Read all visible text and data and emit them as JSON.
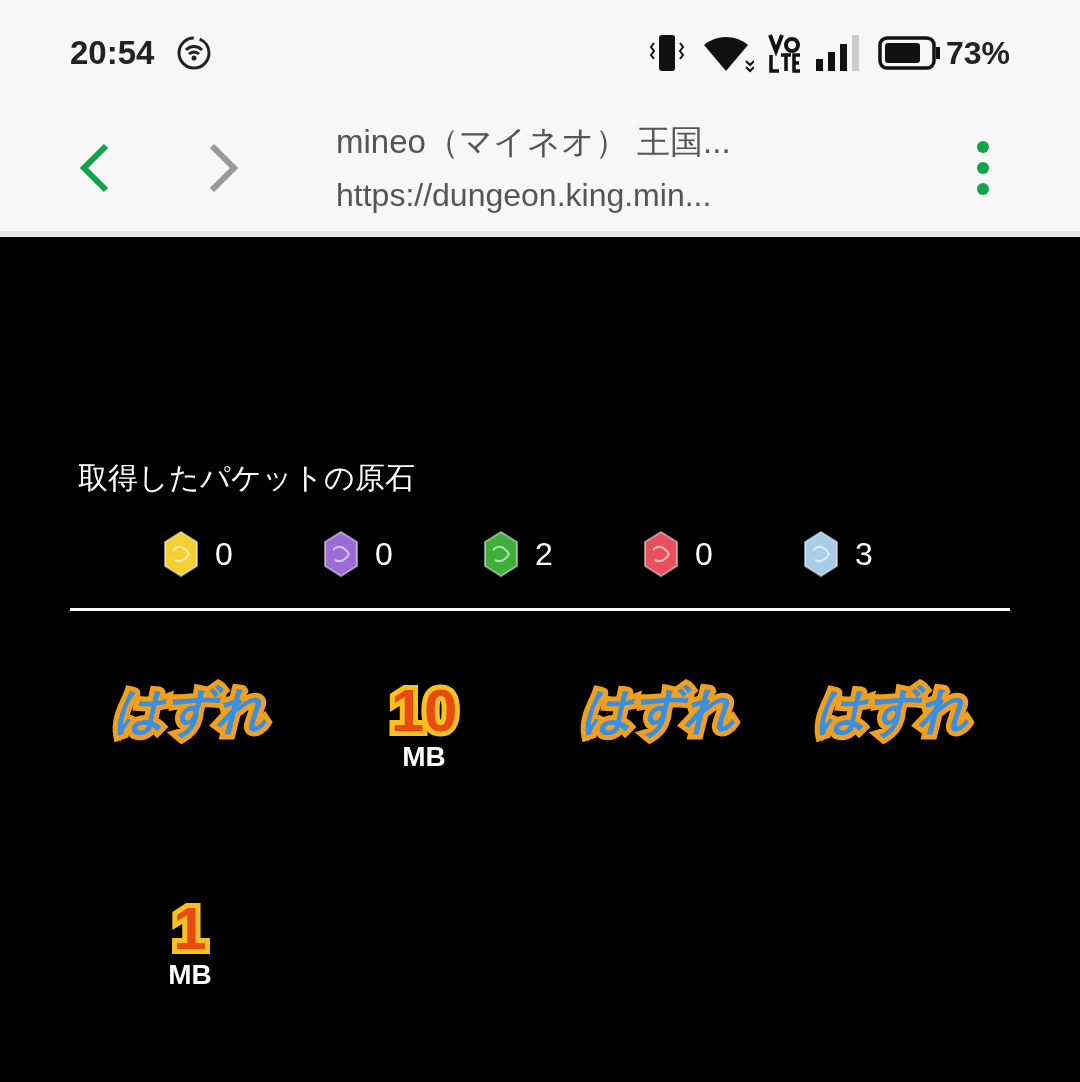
{
  "status_bar": {
    "time": "20:54",
    "battery": "73%"
  },
  "browser": {
    "title": "mineo（マイネオ） 王国...",
    "url": "https://dungeon.king.min..."
  },
  "ore": {
    "heading": "取得したパケットの原石",
    "gems": [
      {
        "color": "#f5d033",
        "count": "0"
      },
      {
        "color": "#9b6cd8",
        "count": "0"
      },
      {
        "color": "#3fae3a",
        "count": "2"
      },
      {
        "color": "#e8505e",
        "count": "0"
      },
      {
        "color": "#a9cde8",
        "count": "3"
      }
    ]
  },
  "results": [
    {
      "kind": "miss",
      "text": "はずれ"
    },
    {
      "kind": "prize",
      "amount": "10",
      "unit": "MB"
    },
    {
      "kind": "miss",
      "text": "はずれ"
    },
    {
      "kind": "miss",
      "text": "はずれ"
    },
    {
      "kind": "prize",
      "amount": "1",
      "unit": "MB"
    }
  ]
}
